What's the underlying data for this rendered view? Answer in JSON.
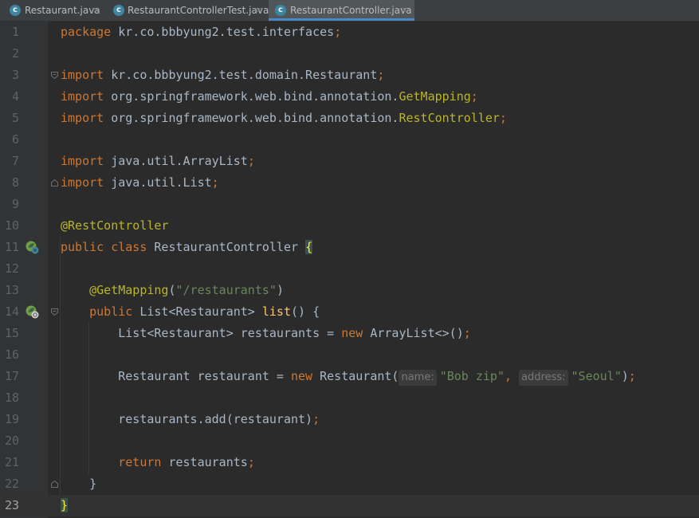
{
  "tabs": [
    {
      "label": "Restaurant.java",
      "close": "×",
      "active": false
    },
    {
      "label": "RestaurantControllerTest.java",
      "close": "×",
      "active": false
    },
    {
      "label": "RestaurantController.java",
      "close": "×",
      "active": true
    }
  ],
  "editor": {
    "line_numbers": [
      "1",
      "2",
      "3",
      "4",
      "5",
      "6",
      "7",
      "8",
      "9",
      "10",
      "11",
      "12",
      "13",
      "14",
      "15",
      "16",
      "17",
      "18",
      "19",
      "20",
      "21",
      "22",
      "23"
    ],
    "current_line": 23,
    "lines": {
      "l1": {
        "kw": "package",
        "rest": " kr.co.bbbyung2.test.interfaces",
        "semi": ";"
      },
      "l3": {
        "kw": "import",
        "rest": " kr.co.bbbyung2.test.domain.Restaurant",
        "semi": ";"
      },
      "l4": {
        "kw": "import",
        "rest": " org.springframework.web.bind.annotation.",
        "ann": "GetMapping",
        "semi": ";"
      },
      "l5": {
        "kw": "import",
        "rest": " org.springframework.web.bind.annotation.",
        "ann": "RestController",
        "semi": ";"
      },
      "l7": {
        "kw": "import",
        "rest": " java.util.ArrayList",
        "semi": ";"
      },
      "l8": {
        "kw": "import",
        "rest": " java.util.List",
        "semi": ";"
      },
      "l10": {
        "ann": "@RestController"
      },
      "l11": {
        "kw1": "public",
        "kw2": " class",
        "rest": " RestaurantController ",
        "brace": "{"
      },
      "l13": {
        "ann": "@GetMapping",
        "open": "(",
        "str": "\"/restaurants\"",
        "close": ")"
      },
      "l14": {
        "kw": "public",
        "rest1": " List<Restaurant> ",
        "fn": "list",
        "rest2": "() {"
      },
      "l15": {
        "rest1": "List<Restaurant> restaurants = ",
        "kw": "new",
        "rest2": " ArrayList<>()",
        "semi": ";"
      },
      "l17": {
        "rest1": "Restaurant restaurant = ",
        "kw": "new",
        "rest2": " Restaurant(",
        "hint1": "name:",
        "str1": "\"Bob zip\"",
        "comma": ",",
        "hint2": "address:",
        "str2": "\"Seoul\"",
        "close": ")",
        "semi": ";"
      },
      "l19": {
        "rest": "restaurants.add(restaurant)",
        "semi": ";"
      },
      "l21": {
        "kw": "return",
        "rest": " restaurants",
        "semi": ";"
      },
      "l22": {
        "rest": "}"
      },
      "l23": {
        "brace": "}"
      }
    }
  },
  "colors": {
    "background": "#2b2b2b",
    "keyword": "#cc7832",
    "annotation": "#bbb529",
    "string": "#6a8759",
    "method": "#ffc66d",
    "text": "#a9b7c6"
  },
  "icons": {
    "file_tab_icon": "java-class-icon",
    "gutter_bean": "spring-bean-icon",
    "fold": "fold-marker-icon"
  }
}
